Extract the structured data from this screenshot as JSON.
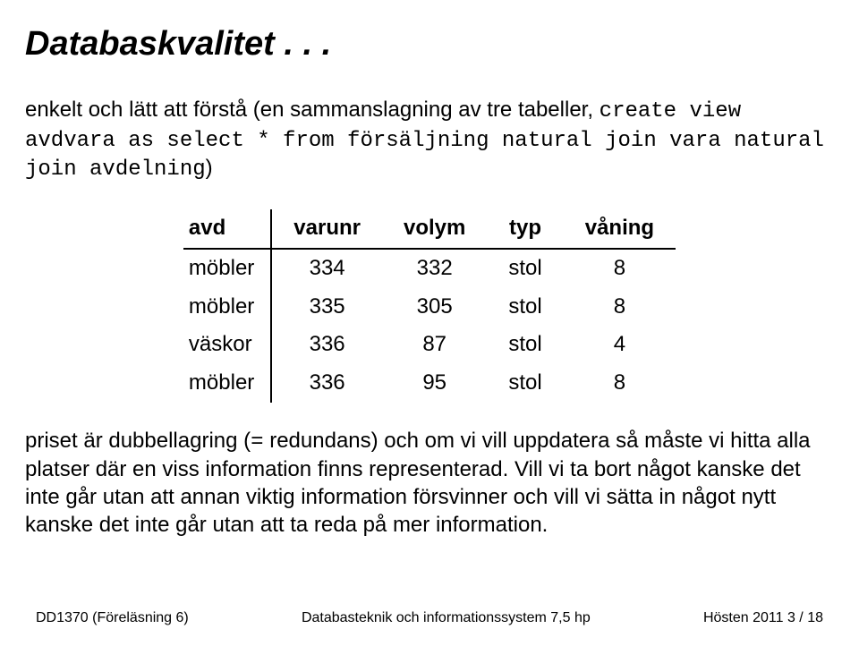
{
  "title": "Databaskvalitet . . .",
  "intro": {
    "t1": "enkelt och lätt att förstå (en sammanslagning av tre tabeller, ",
    "code1": "create view avdvara as select * from försäljning natural join vara natural join avdelning",
    "t2": ")"
  },
  "table": {
    "headers": [
      "avd",
      "varunr",
      "volym",
      "typ",
      "våning"
    ],
    "rows": [
      [
        "möbler",
        "334",
        "332",
        "stol",
        "8"
      ],
      [
        "möbler",
        "335",
        "305",
        "stol",
        "8"
      ],
      [
        "väskor",
        "336",
        "87",
        "stol",
        "4"
      ],
      [
        "möbler",
        "336",
        "95",
        "stol",
        "8"
      ]
    ]
  },
  "para2": {
    "t1": "priset är dubbellagring (",
    "eq": "=",
    "t2": " redundans) och om vi vill uppdatera så måste vi hitta alla platser där en viss information finns representerad. Vill vi ta bort något kanske det inte går utan att annan viktig information försvinner och vill vi sätta in något nytt kanske det inte går utan att ta reda på mer information."
  },
  "footer": {
    "left": "DD1370 (Föreläsning 6)",
    "center": "Databasteknik och informationssystem 7,5 hp",
    "right": "Hösten 2011    3 / 18"
  }
}
